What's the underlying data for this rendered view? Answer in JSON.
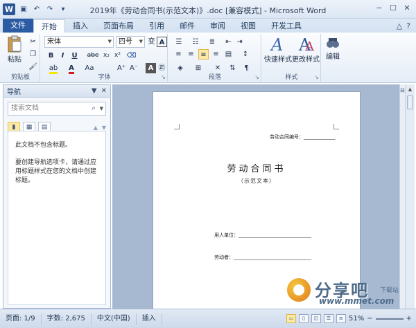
{
  "titlebar": {
    "app_icon": "W",
    "title": "2019年《劳动合同书(示范文本)》.doc [兼容模式] - Microsoft Word"
  },
  "ribbon_tabs": {
    "file": "文件",
    "tabs": [
      "开始",
      "插入",
      "页面布局",
      "引用",
      "邮件",
      "审阅",
      "视图",
      "开发工具"
    ],
    "active": "开始"
  },
  "ribbon": {
    "clipboard": {
      "paste": "粘贴",
      "label": "剪贴板"
    },
    "font": {
      "font_name": "宋体",
      "font_size": "四号",
      "label": "字体",
      "buttons": [
        "B",
        "I",
        "U",
        "abe",
        "x₂",
        "x²",
        "A",
        "Aa",
        "A⁺",
        "A⁻"
      ]
    },
    "paragraph": {
      "label": "段落"
    },
    "styles": {
      "quick_styles": "快速样式",
      "change_styles": "更改样式",
      "label": "样式"
    },
    "editing": {
      "label": "编辑"
    }
  },
  "nav": {
    "title": "导航",
    "search_placeholder": "搜索文档",
    "message1": "此文档不包含标题。",
    "message2": "要创建导航选项卡，请通过应用标题样式在您的文档中创建标题。"
  },
  "document": {
    "contract_number": "劳动合同编号：_____________",
    "title": "劳动合同书",
    "subtitle": "（示范文本）",
    "employer": "用人单位：______________________________",
    "employee": "劳动者：________________________________"
  },
  "status": {
    "page": "页面: 1/9",
    "words": "字数: 2,675",
    "language": "中文(中国)",
    "mode": "插入",
    "zoom": "51%"
  },
  "watermark": {
    "brand": "分享吧",
    "badge": "下载站",
    "url": "www.mmet.com"
  }
}
